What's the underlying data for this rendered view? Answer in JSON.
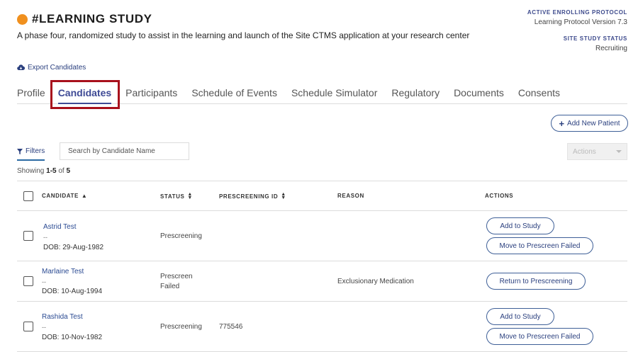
{
  "study": {
    "title": "#LEARNING STUDY",
    "description": "A phase four, randomized study to assist in the learning and launch of the Site CTMS application at your research center",
    "active_protocol_label": "ACTIVE ENROLLING PROTOCOL",
    "active_protocol_value": "Learning Protocol Version 7.3",
    "site_status_label": "SITE STUDY STATUS",
    "site_status_value": "Recruiting",
    "status_color": "#f0901e"
  },
  "export_label": "Export Candidates",
  "tabs": [
    {
      "label": "Profile"
    },
    {
      "label": "Candidates"
    },
    {
      "label": "Participants"
    },
    {
      "label": "Schedule of Events"
    },
    {
      "label": "Schedule Simulator"
    },
    {
      "label": "Regulatory"
    },
    {
      "label": "Documents"
    },
    {
      "label": "Consents"
    }
  ],
  "active_tab": "Candidates",
  "add_patient_label": "Add New Patient",
  "filters_label": "Filters",
  "search_placeholder": "Search by Candidate Name",
  "actions_select_label": "Actions",
  "showing": {
    "prefix": "Showing",
    "range": "1-5",
    "of": "of",
    "total": "5"
  },
  "columns": {
    "candidate": "CANDIDATE",
    "status": "STATUS",
    "prescreening_id": "PRESCREENING ID",
    "reason": "REASON",
    "actions": "ACTIONS"
  },
  "rows": [
    {
      "name": "Astrid Test",
      "dash": "--",
      "dob": "DOB: 29-Aug-1982",
      "status": "Prescreening",
      "prescreening_id": "",
      "reason": "",
      "actions": [
        "Add to Study",
        "Move to Prescreen Failed"
      ]
    },
    {
      "name": "Marlaine Test",
      "dash": "--",
      "dob": "DOB: 10-Aug-1994",
      "status_line1": "Prescreen",
      "status_line2": "Failed",
      "prescreening_id": "",
      "reason": "Exclusionary Medication",
      "actions": [
        "Return to Prescreening"
      ]
    },
    {
      "name": "Rashida Test",
      "dash": "--",
      "dob": "DOB: 10-Nov-1982",
      "status": "Prescreening",
      "prescreening_id": "775546",
      "reason": "",
      "actions": [
        "Add to Study",
        "Move to Prescreen Failed"
      ]
    }
  ],
  "colors": {
    "accent": "#3e4a95",
    "link": "#2a4a92",
    "highlight": "#a8101c"
  }
}
